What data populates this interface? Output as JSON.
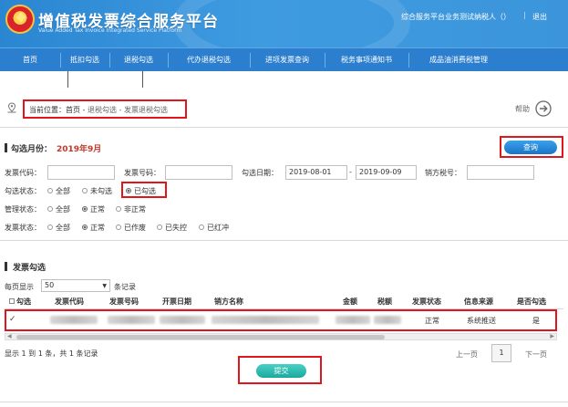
{
  "header": {
    "title": "增值税发票综合服务平台",
    "subtitle": "Value Added Tax Invoice Integrated Service Platform",
    "user": "综合服务平台业务测试纳税人（）",
    "separator": "|",
    "logout": "退出"
  },
  "nav": {
    "items": [
      {
        "label": "首页"
      },
      {
        "label": "抵扣勾选"
      },
      {
        "label": "退税勾选"
      },
      {
        "label": "代办退税勾选"
      },
      {
        "label": "进项发票查询"
      },
      {
        "label": "税务事项通知书"
      },
      {
        "label": "成品油消费税管理"
      }
    ]
  },
  "breadcrumb": {
    "prefix": "当前位置：首页 - ",
    "trail": "退税勾选 - 发票退税勾选",
    "help": "帮助"
  },
  "query": {
    "month_label": "勾选月份：",
    "month_value": "2019年9月",
    "button": "查询",
    "invoice_code_label": "发票代码：",
    "invoice_code_value": "",
    "invoice_number_label": "发票号码：",
    "invoice_number_value": "",
    "date_label": "勾选日期：",
    "date_start": "2019-08-01",
    "date_sep": "-",
    "date_end": "2019-09-09",
    "seller_tax_label": "销方税号：",
    "seller_tax_value": "",
    "check_status": {
      "label": "勾选状态：",
      "options": [
        "全部",
        "未勾选",
        "已勾选"
      ],
      "selected": "已勾选"
    },
    "manage_status": {
      "label": "管理状态：",
      "options": [
        "全部",
        "正常",
        "非正常"
      ],
      "selected": "正常"
    },
    "invoice_status": {
      "label": "发票状态：",
      "options": [
        "全部",
        "正常",
        "已作废",
        "已失控",
        "已红冲"
      ],
      "selected": "正常"
    }
  },
  "table": {
    "title": "发票勾选",
    "per_page_label": "每页显示",
    "per_page_value": "50",
    "per_page_suffix": "条记录",
    "columns": [
      "勾选",
      "发票代码",
      "发票号码",
      "开票日期",
      "销方名称",
      "金额",
      "税额",
      "发票状态",
      "信息来源",
      "是否勾选"
    ],
    "rows": [
      {
        "check": "✓",
        "status": "正常",
        "source": "系统推送",
        "selected": "是"
      }
    ],
    "summary": "显示 1 到 1 条，共 1 条记录",
    "prev": "上一页",
    "page": "1",
    "next": "下一页"
  },
  "submit": "提交",
  "colors": {
    "header_blue": "#2b86d2",
    "nav_blue": "#2c7fcf",
    "highlight_red": "#e0161d",
    "query_button": "#1b73c6",
    "submit_button": "#1ca89d",
    "month_red": "#c0392b"
  }
}
